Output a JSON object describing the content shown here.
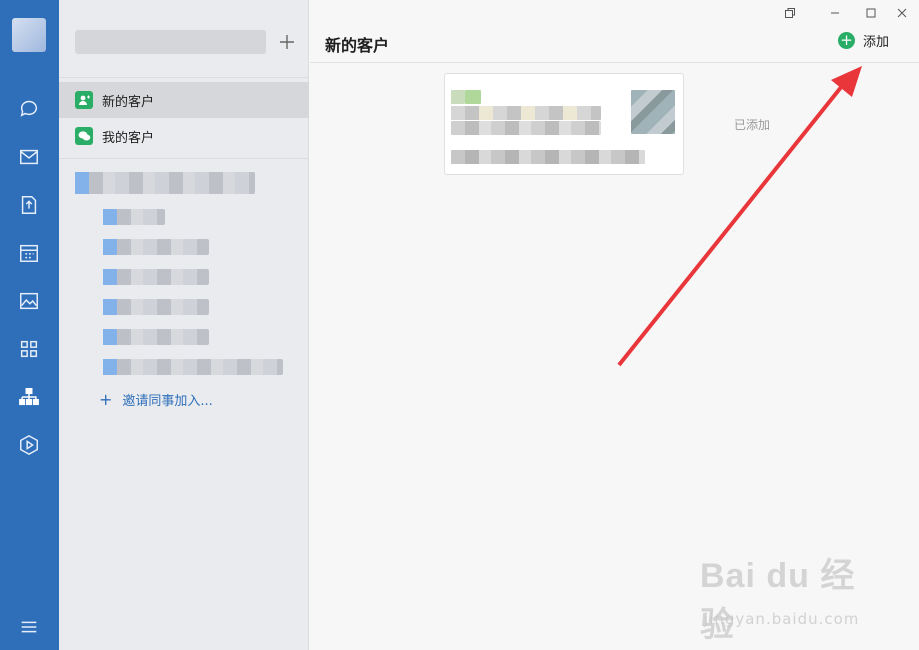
{
  "sidebar": {
    "items": [
      {
        "name": "new-customers",
        "label": "新的客户"
      },
      {
        "name": "my-customers",
        "label": "我的客户"
      }
    ],
    "invite_label": "邀请同事加入..."
  },
  "main": {
    "title": "新的客户",
    "add_label": "添加",
    "added_status": "已添加"
  },
  "watermark": {
    "brand": "Bai du 经验",
    "url": "jingyan.baidu.com"
  },
  "colors": {
    "rail": "#2f6fba",
    "accent_green": "#2aae67",
    "link_blue": "#2f6fba",
    "annotation_red": "#e8363a"
  }
}
